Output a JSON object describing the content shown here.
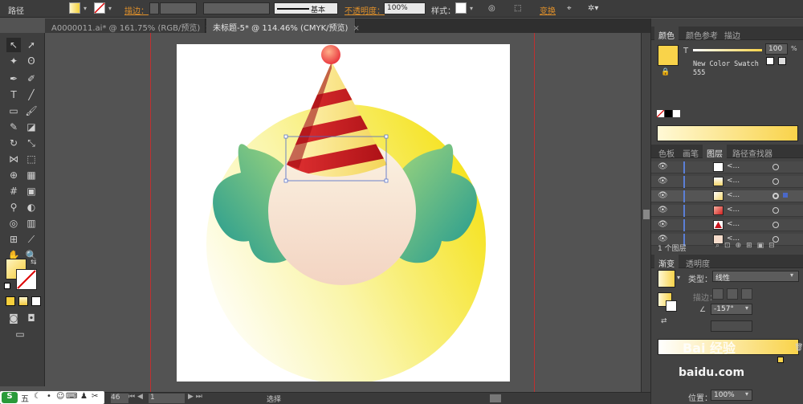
{
  "control_bar": {
    "path_label": "路径",
    "stroke_label": "描边：",
    "basic_label": "基本",
    "opacity_label": "不透明度：",
    "opacity_value": "100%",
    "style_label": "样式：",
    "transform_label": "变换"
  },
  "tabs": [
    {
      "label": "A0000011.ai* @ 161.75% (RGB/预览)",
      "close": "×"
    },
    {
      "label": "未标题-5* @ 114.46% (CMYK/预览)",
      "close": "×"
    }
  ],
  "panels": {
    "color_tabs": [
      "颜色",
      "颜色参考",
      "描边"
    ],
    "tint_label": "T",
    "tint_value": "100",
    "swatch_name": "New Color Swatch",
    "swatch_number": "555",
    "layers_tabs": [
      "色板",
      "画笔",
      "图层",
      "路径查找器"
    ],
    "layer_item_label": "<...",
    "layer_count": "1 个图层",
    "gradient_tabs": [
      "渐变",
      "透明度"
    ],
    "type_label": "类型：",
    "type_value": "线性",
    "stroke_label": "描边：",
    "angle_value": "-157°",
    "position_label": "位置：",
    "position_value": "100%",
    "watermark": "Bai 经验",
    "watermark2": "baidu.com"
  },
  "status": {
    "zoom": "46",
    "page": "1",
    "select_label": "选择"
  },
  "ime": {
    "label": "五"
  },
  "colors": {
    "accent_yellow": "#f9d34a",
    "hat_red": "#c9141d",
    "teal": "#2aa397",
    "face": "#f6d9c6"
  }
}
